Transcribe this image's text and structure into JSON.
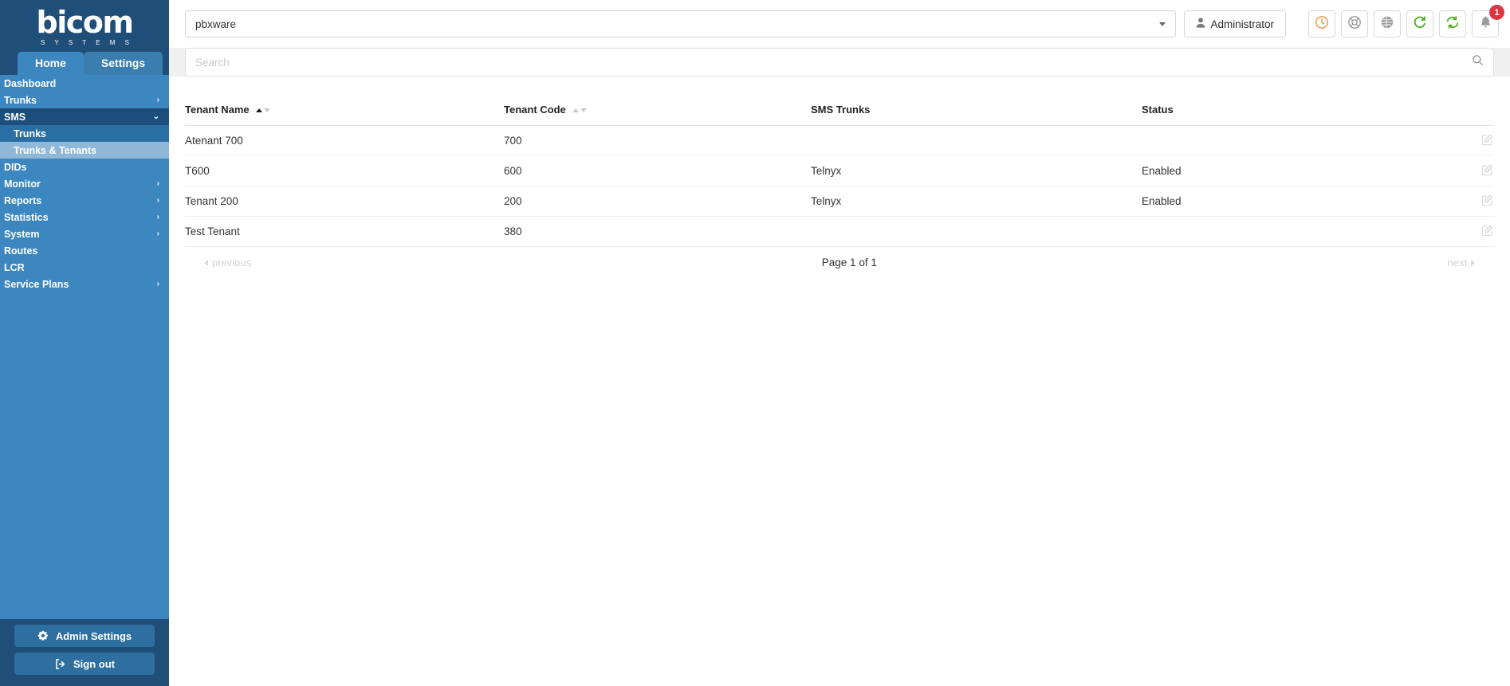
{
  "brand": {
    "name": "bicom",
    "tagline": "S Y S T E M S",
    "accent": "#3c87bf",
    "sidebar_dark": "#1f4e79"
  },
  "tabs": [
    {
      "label": "Home",
      "active": true
    },
    {
      "label": "Settings",
      "active": false
    }
  ],
  "sidebar": {
    "items": [
      {
        "label": "Dashboard",
        "has_children": false,
        "state": "normal",
        "icon": ""
      },
      {
        "label": "Trunks",
        "has_children": true,
        "state": "normal",
        "icon": "chevron-right-icon"
      },
      {
        "label": "SMS",
        "has_children": true,
        "state": "expanded",
        "icon": "chevron-down-icon"
      },
      {
        "label": "Trunks",
        "has_children": false,
        "state": "sub",
        "icon": ""
      },
      {
        "label": "Trunks & Tenants",
        "has_children": false,
        "state": "sub-selected",
        "icon": ""
      },
      {
        "label": "DIDs",
        "has_children": false,
        "state": "normal",
        "icon": ""
      },
      {
        "label": "Monitor",
        "has_children": true,
        "state": "normal",
        "icon": "chevron-right-icon"
      },
      {
        "label": "Reports",
        "has_children": true,
        "state": "normal",
        "icon": "chevron-right-icon"
      },
      {
        "label": "Statistics",
        "has_children": true,
        "state": "normal",
        "icon": "chevron-right-icon"
      },
      {
        "label": "System",
        "has_children": true,
        "state": "normal",
        "icon": "chevron-right-icon"
      },
      {
        "label": "Routes",
        "has_children": false,
        "state": "normal",
        "icon": ""
      },
      {
        "label": "LCR",
        "has_children": false,
        "state": "normal",
        "icon": ""
      },
      {
        "label": "Service Plans",
        "has_children": true,
        "state": "normal",
        "icon": "chevron-right-icon"
      }
    ],
    "admin_settings_label": "Admin Settings",
    "sign_out_label": "Sign out"
  },
  "topbar": {
    "server_select_value": "pbxware",
    "user_label": "Administrator",
    "icons": [
      {
        "name": "clock-icon",
        "color": "#e8953a"
      },
      {
        "name": "life-ring-icon",
        "color": "#8c8c8c"
      },
      {
        "name": "globe-icon",
        "color": "#8c8c8c"
      },
      {
        "name": "reload-icon",
        "color": "#4caf1f"
      },
      {
        "name": "sync-icon",
        "color": "#4caf1f"
      },
      {
        "name": "bell-icon",
        "color": "#9a9a9a"
      }
    ],
    "notification_count": "1",
    "notification_color": "#dc3545"
  },
  "search": {
    "placeholder": "Search",
    "value": "",
    "icon": "search-icon"
  },
  "table": {
    "columns": [
      {
        "label": "Tenant Name",
        "sortable": true,
        "sort": "asc"
      },
      {
        "label": "Tenant Code",
        "sortable": true,
        "sort": "none"
      },
      {
        "label": "SMS Trunks",
        "sortable": false,
        "sort": "none"
      },
      {
        "label": "Status",
        "sortable": false,
        "sort": "none"
      },
      {
        "label": "",
        "sortable": false,
        "sort": "none"
      }
    ],
    "rows": [
      {
        "tenant_name": "Atenant 700",
        "tenant_code": "700",
        "sms_trunks": "",
        "status": "",
        "action_icon": "edit-icon"
      },
      {
        "tenant_name": "T600",
        "tenant_code": "600",
        "sms_trunks": "Telnyx",
        "status": "Enabled",
        "action_icon": "edit-icon"
      },
      {
        "tenant_name": "Tenant 200",
        "tenant_code": "200",
        "sms_trunks": "Telnyx",
        "status": "Enabled",
        "action_icon": "edit-icon"
      },
      {
        "tenant_name": "Test Tenant",
        "tenant_code": "380",
        "sms_trunks": "",
        "status": "",
        "action_icon": "edit-icon"
      }
    ]
  },
  "pagination": {
    "previous_label": "previous",
    "page_label": "Page 1 of 1",
    "next_label": "next"
  }
}
